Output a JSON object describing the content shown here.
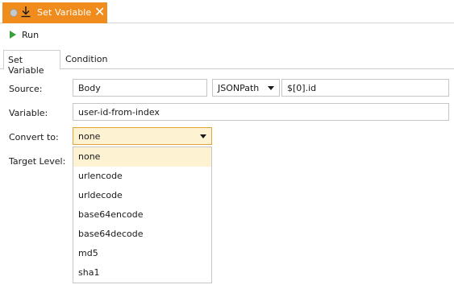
{
  "window_tab": {
    "title": "Set Variable",
    "close_glyph": "✕",
    "icons": [
      "circle-icon",
      "step-into-icon"
    ]
  },
  "toolbar": {
    "run_label": "Run",
    "run_icon": "play-icon",
    "run_color": "#38a13c"
  },
  "tabs": [
    {
      "label": "Set Variable",
      "active": true
    },
    {
      "label": "Condition",
      "active": false
    }
  ],
  "form": {
    "source": {
      "label": "Source:",
      "value": "Body",
      "mode": "JSONPath",
      "expression": "$[0].id"
    },
    "variable": {
      "label": "Variable:",
      "value": "user-id-from-index"
    },
    "convert_to": {
      "label": "Convert to:",
      "value": "none"
    },
    "target_level": {
      "label": "Target Level:"
    }
  },
  "convert_options": [
    "none",
    "urlencode",
    "urldecode",
    "base64encode",
    "base64decode",
    "md5",
    "sha1"
  ],
  "colors": {
    "accent": "#ef8c1d",
    "highlight": "#fdf3d3",
    "focus_border": "#e3a33b"
  }
}
